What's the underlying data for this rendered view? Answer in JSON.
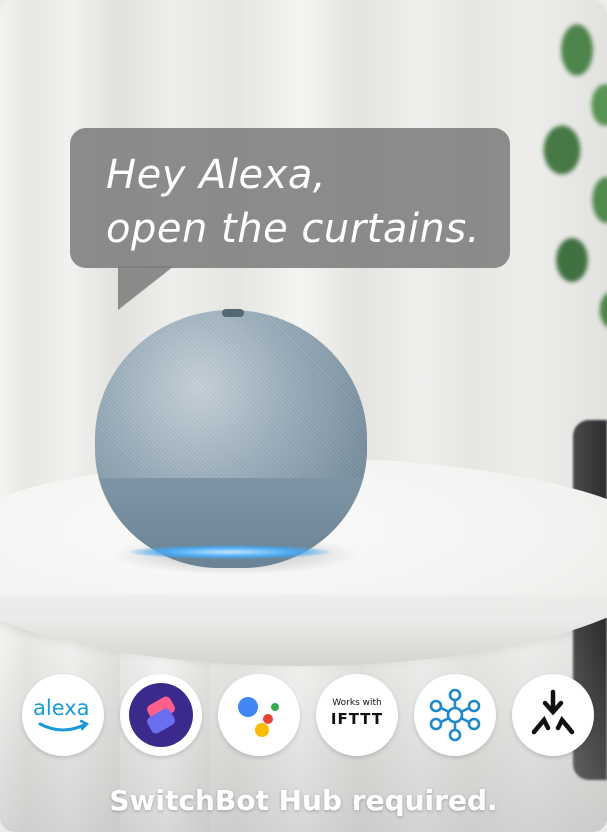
{
  "bubble": {
    "line1": "Hey Alexa,",
    "line2": "open the curtains."
  },
  "icons": [
    {
      "name": "alexa-icon",
      "label": "alexa",
      "color": "#1a9ad6"
    },
    {
      "name": "shortcuts-icon",
      "color": "#3b2a8c"
    },
    {
      "name": "google-assistant-icon",
      "colors": [
        "#4285f4",
        "#ea4335",
        "#fbbc05",
        "#34a853"
      ]
    },
    {
      "name": "ifttt-icon",
      "small_label": "Works with",
      "big_label": "IFTTT"
    },
    {
      "name": "smartthings-icon",
      "color": "#1e88c8"
    },
    {
      "name": "matter-icon",
      "color": "#111111"
    }
  ],
  "caption": "SwitchBot Hub required."
}
